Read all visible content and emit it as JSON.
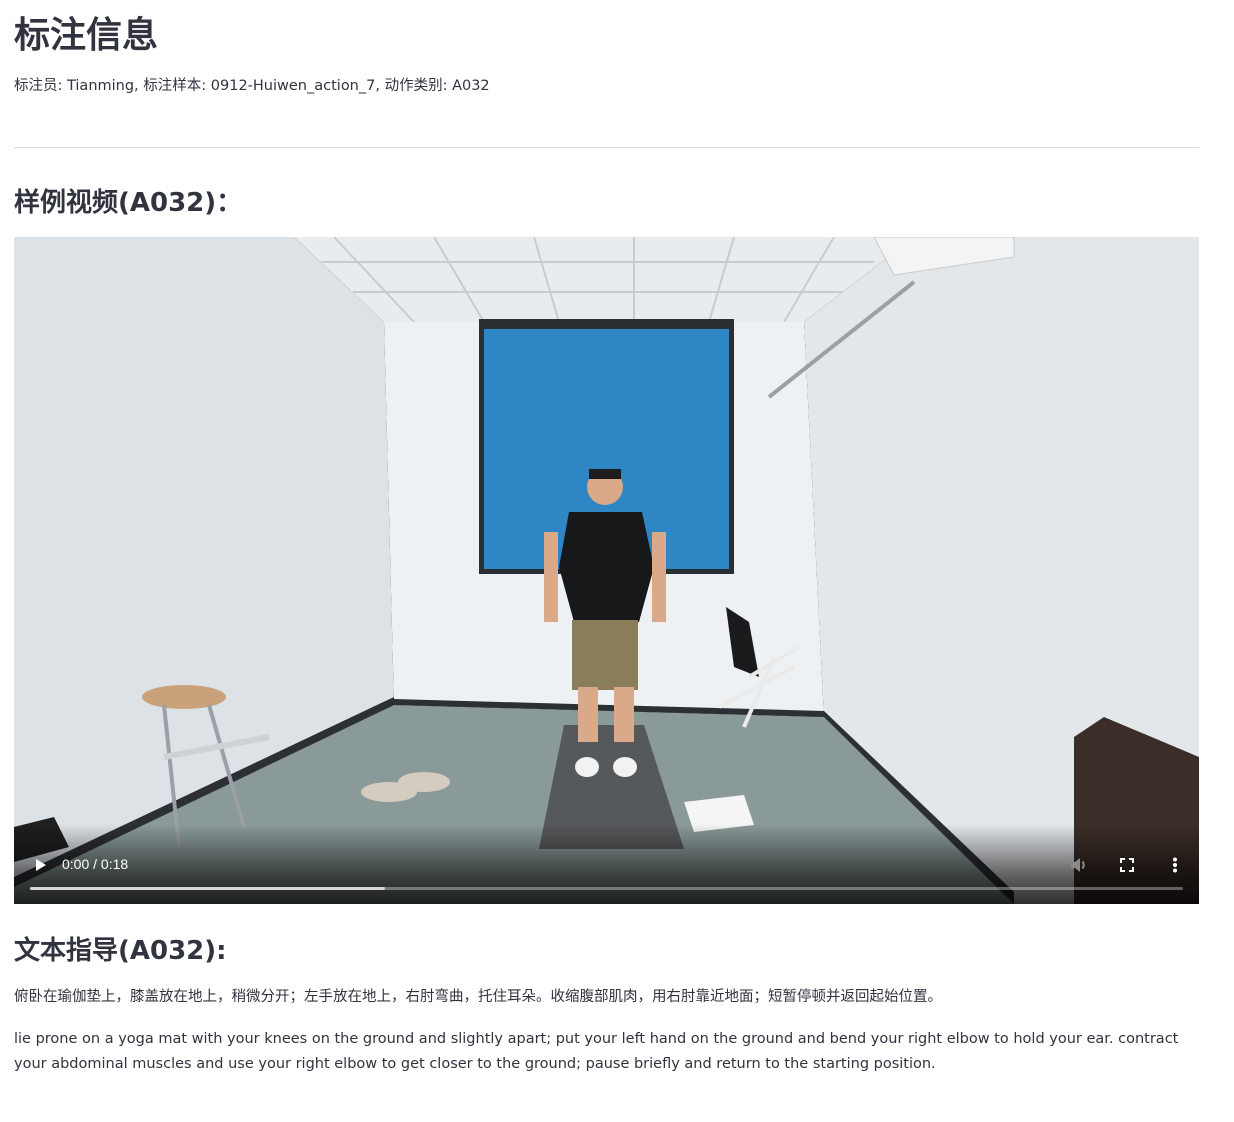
{
  "header": {
    "title": "标注信息",
    "meta": "标注员: Tianming, 标注样本: 0912-Huiwen_action_7, 动作类别: A032"
  },
  "example_section": {
    "heading": "样例视频(A032)："
  },
  "video": {
    "time_display": "0:00 / 0:18",
    "buffered_fraction": 0.308,
    "played_fraction": 0.0
  },
  "guidance_section": {
    "heading": "文本指导(A032):",
    "text_zh": "俯卧在瑜伽垫上，膝盖放在地上，稍微分开；左手放在地上，右肘弯曲，托住耳朵。收缩腹部肌肉，用右肘靠近地面；短暂停顿并返回起始位置。",
    "text_en": "lie prone on a yoga mat with your knees on the ground and slightly apart; put your left hand on the ground and bend your right elbow to hold your ear. contract your abdominal muscles and use your right elbow to get closer to the ground; pause briefly and return to the starting position."
  },
  "icons": {
    "play": "play-icon",
    "volume": "volume-icon",
    "fullscreen": "fullscreen-icon",
    "more": "more-vertical-icon"
  }
}
